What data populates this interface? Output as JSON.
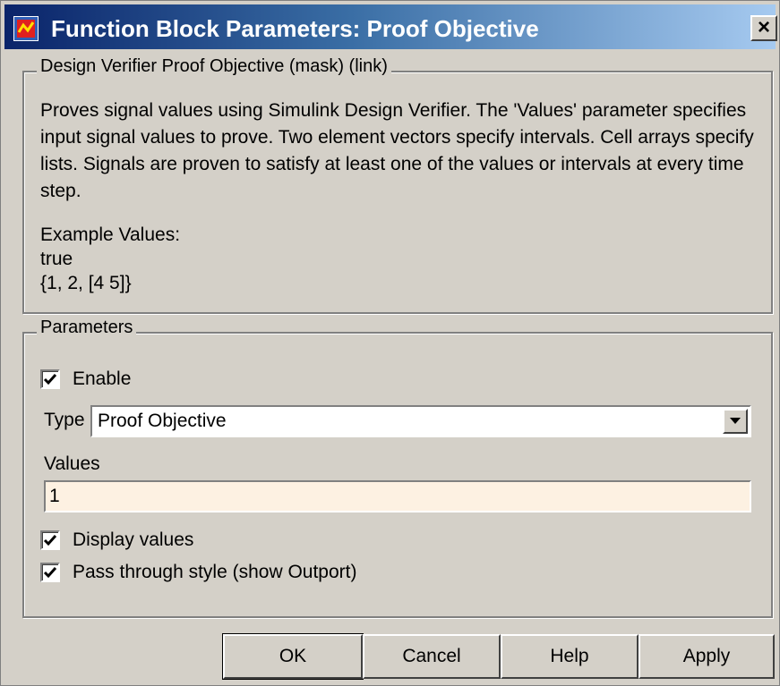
{
  "window": {
    "title": "Function Block Parameters: Proof Objective",
    "close_label": "×"
  },
  "mask_group": {
    "label": "Design Verifier Proof Objective (mask) (link)",
    "description": "Proves signal values using Simulink Design Verifier.  The 'Values' parameter specifies input signal values to prove. Two element vectors specify intervals.  Cell arrays specify lists. Signals are proven to satisfy at least one of the values or intervals at every time step.",
    "example_title": "Example Values:",
    "example_lines": [
      "true",
      "{1, 2, [4 5]}"
    ]
  },
  "parameters_group": {
    "label": "Parameters",
    "enable": {
      "label": "Enable",
      "checked": true
    },
    "type": {
      "label": "Type",
      "selected_value": "Proof Objective"
    },
    "values": {
      "label": "Values",
      "input_value": "1"
    },
    "display_values": {
      "label": "Display values",
      "checked": true
    },
    "pass_through": {
      "label": "Pass through style (show Outport)",
      "checked": true
    }
  },
  "buttons": {
    "ok": "OK",
    "cancel": "Cancel",
    "help": "Help",
    "apply": "Apply"
  },
  "icons": {
    "app_icon": "simulink-block-icon",
    "close_icon": "close-icon",
    "dropdown_icon": "chevron-down-icon",
    "check_icon": "checkmark-icon"
  },
  "colors": {
    "titlebar_start": "#0a246a",
    "titlebar_end": "#a6caf0",
    "dialog_bg": "#d4d0c8",
    "values_input_bg": "#fdf1e2"
  }
}
